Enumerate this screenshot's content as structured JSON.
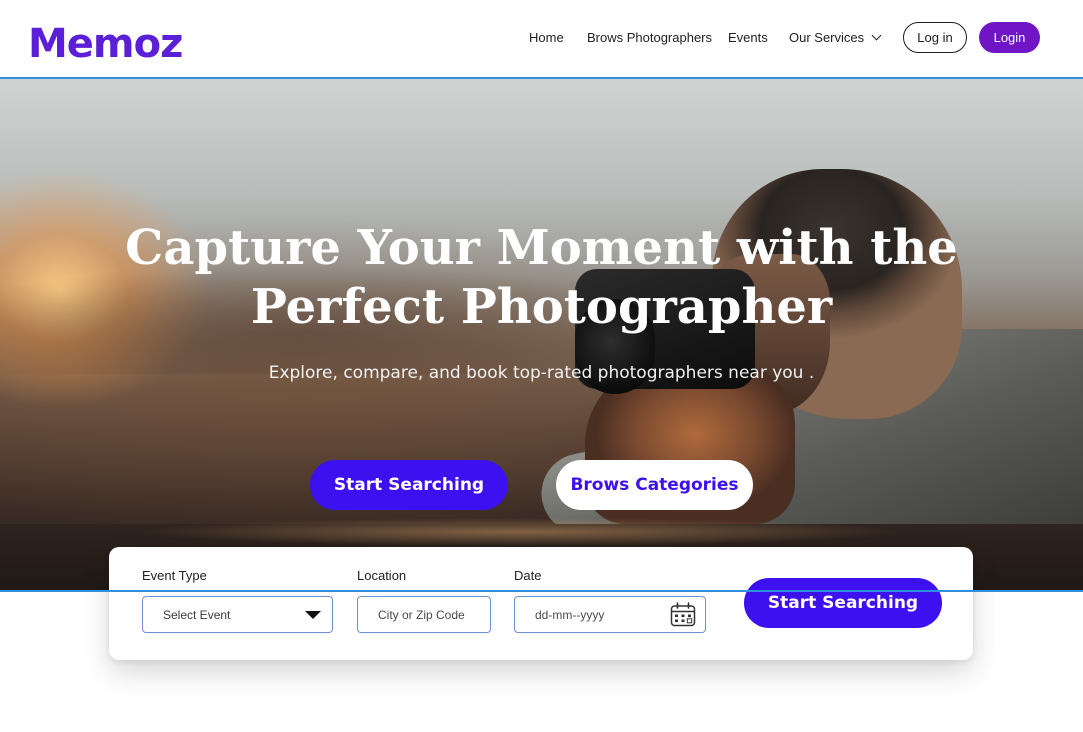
{
  "colors": {
    "brand": "#5a1fd6",
    "primary_button": "#3d10f0",
    "login_button": "#6f15c6",
    "accent_text": "#3d10f0"
  },
  "header": {
    "logo": "Memoz",
    "nav": [
      {
        "label": "Home"
      },
      {
        "label": "Brows Photographers"
      },
      {
        "label": "Events"
      },
      {
        "label": "Our Services",
        "icon": "chevron-down-icon"
      }
    ],
    "login_outline_label": "Log in",
    "login_fill_label": "Login"
  },
  "hero": {
    "title_line1": "Capture Your Moment with the",
    "title_line2": "Perfect Photographer",
    "subtitle": "Explore, compare, and book top-rated photographers near you .",
    "primary_button": "Start Searching",
    "secondary_button": "Brows Categories"
  },
  "search": {
    "event_type": {
      "label": "Event Type",
      "value": "Select Event",
      "icon": "caret-down-icon"
    },
    "location": {
      "label": "Location",
      "placeholder": "City or Zip Code"
    },
    "date": {
      "label": "Date",
      "placeholder": "dd-mm--yyyy",
      "icon": "calendar-icon"
    },
    "submit_label": "Start Searching"
  }
}
